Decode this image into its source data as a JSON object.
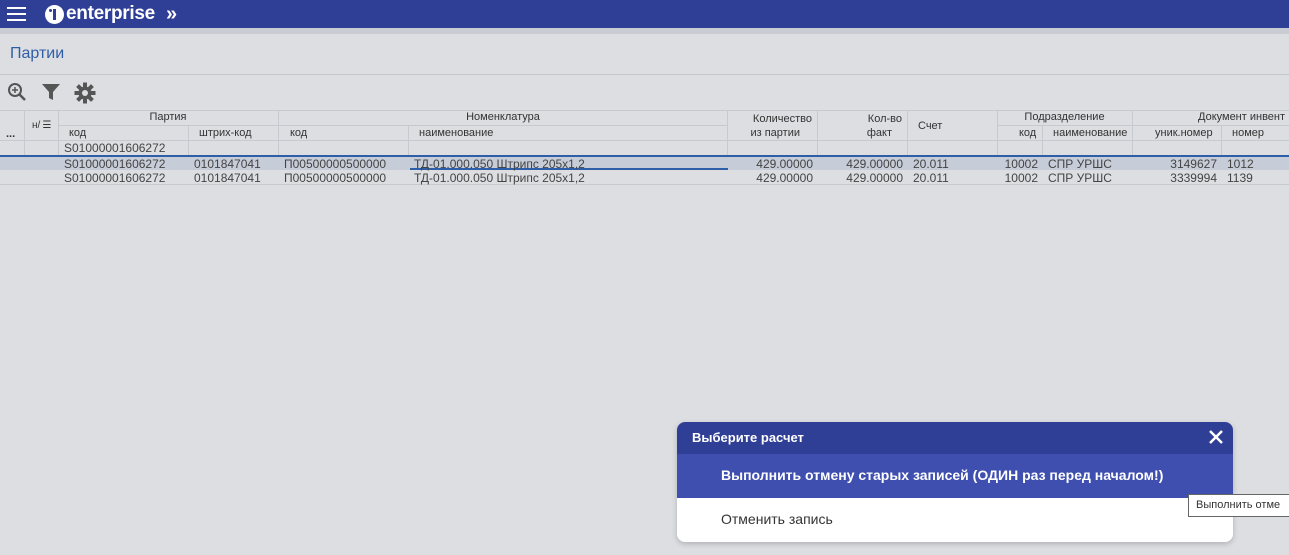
{
  "app": {
    "logo_text": "enterprise"
  },
  "page": {
    "title": "Партии"
  },
  "toolbar": {
    "search_icon": "zoom-search-icon",
    "filter_icon": "filter-icon",
    "settings_icon": "gear-icon"
  },
  "grid": {
    "row_menu": "...",
    "col_num": "н/",
    "groups": {
      "party": "Партия",
      "nomenclature": "Номенклатура",
      "qty_line1": "Количество",
      "qty_line2": "из партии",
      "fact_line1": "Кол-во",
      "fact_line2": "факт",
      "account": "Счет",
      "division": "Подразделение",
      "inventory_doc": "Документ инвент"
    },
    "subheaders": {
      "party_code": "код",
      "barcode": "штрих-код",
      "nom_code": "код",
      "nom_name": "наименование",
      "div_code": "код",
      "div_name": "наименование",
      "uniq_num": "уник.номер",
      "doc_num": "номер"
    },
    "filter_value": "S01000001606272",
    "rows": [
      {
        "party_code": "S01000001606272",
        "barcode": "0101847041",
        "nom_code": "П00500000500000",
        "nom_name": "ТД-01.000.050 Штрипс 205x1,2",
        "qty": "429.00000",
        "fact": "429.00000",
        "account": "20.011",
        "div_code": "10002",
        "div_name": "СПР УРШС",
        "uniq": "3149627",
        "doc": "1012"
      },
      {
        "party_code": "S01000001606272",
        "barcode": "0101847041",
        "nom_code": "П00500000500000",
        "nom_name": "ТД-01.000.050 Штрипс 205x1,2",
        "qty": "429.00000",
        "fact": "429.00000",
        "account": "20.011",
        "div_code": "10002",
        "div_name": "СПР УРШС",
        "uniq": "3339994",
        "doc": "1139"
      }
    ]
  },
  "dialog": {
    "title": "Выберите расчет",
    "options": [
      "Выполнить отмену старых записей (ОДИН раз перед началом!)",
      "Отменить запись"
    ]
  },
  "tooltip": {
    "text": "Выполнить отме"
  },
  "colors": {
    "header_bar": "#2f3f96",
    "dialog_highlight": "#3f4fb0",
    "title_blue": "#2f5ea8",
    "background": "#dcdee2"
  }
}
